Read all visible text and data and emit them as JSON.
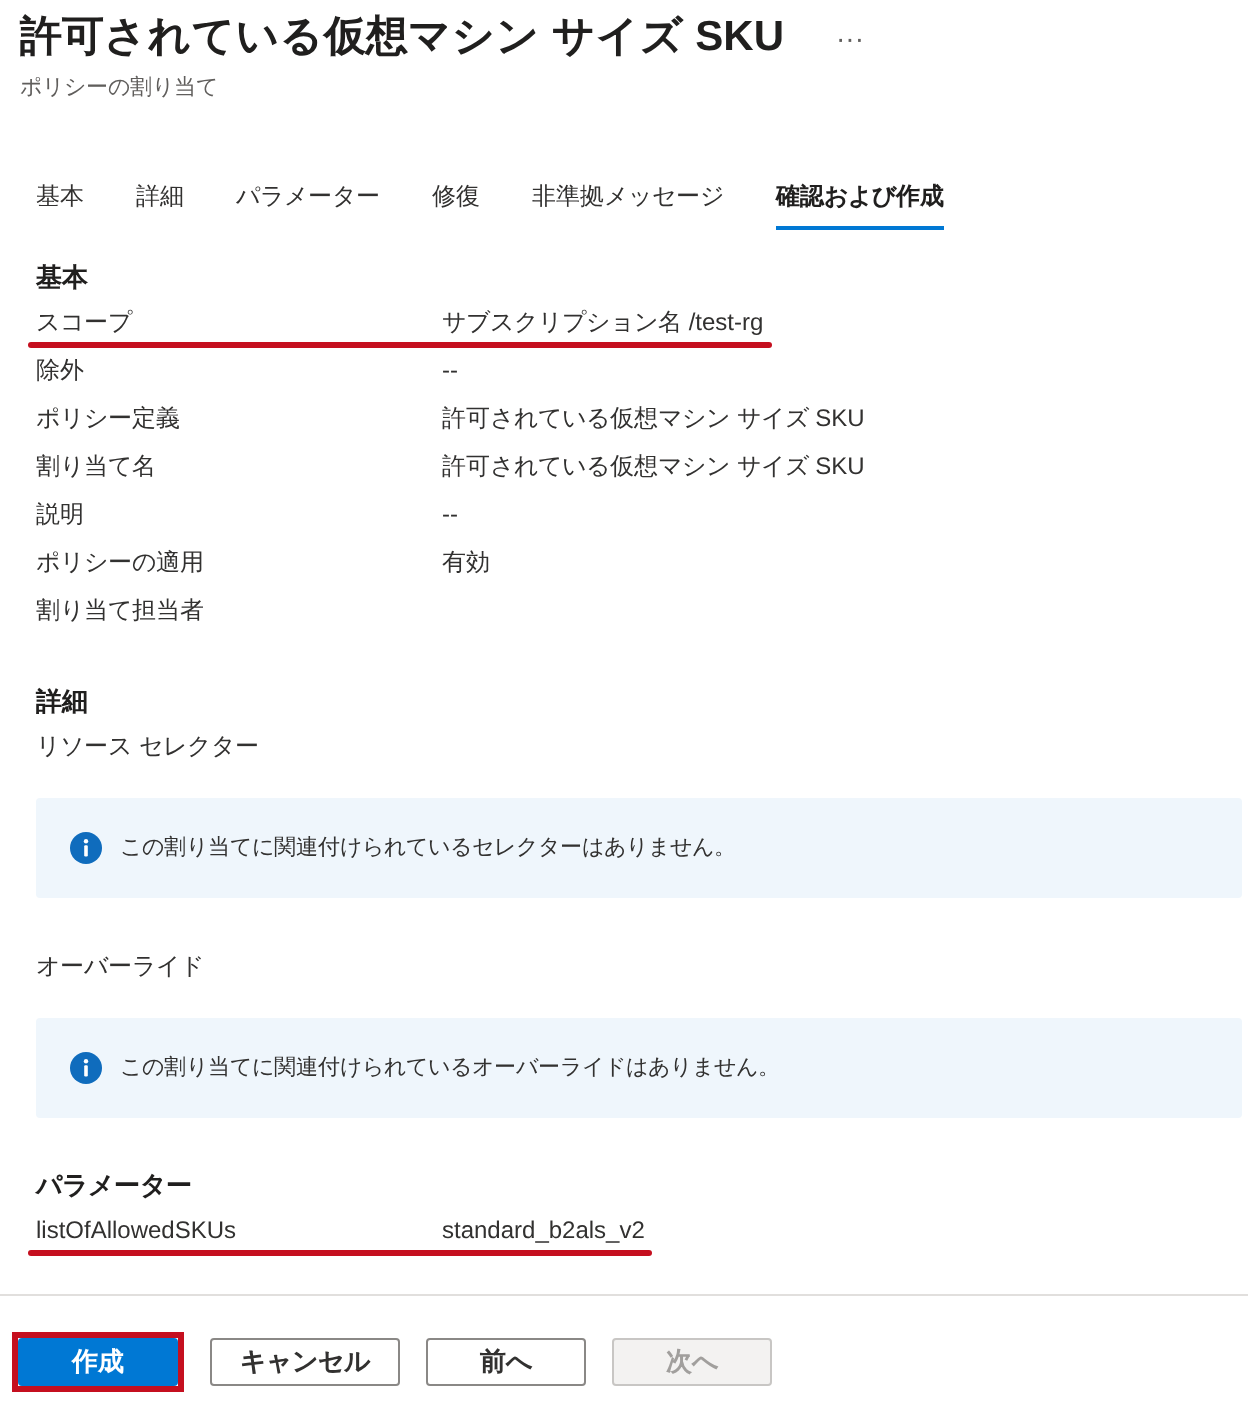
{
  "header": {
    "title": "許可されている仮想マシン サイズ SKU",
    "more": "···",
    "subtitle": "ポリシーの割り当て"
  },
  "tabs": [
    {
      "label": "基本",
      "selected": false
    },
    {
      "label": "詳細",
      "selected": false
    },
    {
      "label": "パラメーター",
      "selected": false
    },
    {
      "label": "修復",
      "selected": false
    },
    {
      "label": "非準拠メッセージ",
      "selected": false
    },
    {
      "label": "確認および作成",
      "selected": true
    }
  ],
  "sections": [
    {
      "heading": "基本",
      "items": [
        {
          "kind": "row",
          "label": "スコープ",
          "value": "サブスクリプション名 /test-rg",
          "highlighted": true
        },
        {
          "kind": "row",
          "label": "除外",
          "value": "--",
          "highlighted": false
        },
        {
          "kind": "row",
          "label": "ポリシー定義",
          "value": "許可されている仮想マシン サイズ SKU",
          "highlighted": false
        },
        {
          "kind": "row",
          "label": "割り当て名",
          "value": "許可されている仮想マシン サイズ SKU",
          "highlighted": false
        },
        {
          "kind": "row",
          "label": "説明",
          "value": "--",
          "highlighted": false
        },
        {
          "kind": "row",
          "label": "ポリシーの適用",
          "value": "有効",
          "highlighted": false
        },
        {
          "kind": "row",
          "label": "割り当て担当者",
          "highlighted": false
        }
      ]
    },
    {
      "heading": "詳細",
      "items": [
        {
          "kind": "text",
          "text": "リソース セレクター"
        },
        {
          "kind": "info",
          "text": "この割り当てに関連付けられているセレクターはありません。"
        },
        {
          "kind": "text",
          "text": "オーバーライド"
        },
        {
          "kind": "info",
          "text": "この割り当てに関連付けられているオーバーライドはありません。"
        }
      ]
    },
    {
      "heading": "パラメーター",
      "items": [
        {
          "kind": "row",
          "label": "listOfAllowedSKUs",
          "value": "standard_b2als_v2",
          "highlighted": true
        }
      ]
    }
  ],
  "footer": {
    "buttons": [
      {
        "label": "作成",
        "kind": "primary",
        "disabled": false,
        "highlighted": true
      },
      {
        "label": "キャンセル",
        "kind": "default",
        "disabled": false,
        "highlighted": false
      },
      {
        "label": "前へ",
        "kind": "default",
        "disabled": false,
        "highlighted": false
      },
      {
        "label": "次へ",
        "kind": "default",
        "disabled": true,
        "highlighted": false
      }
    ]
  }
}
